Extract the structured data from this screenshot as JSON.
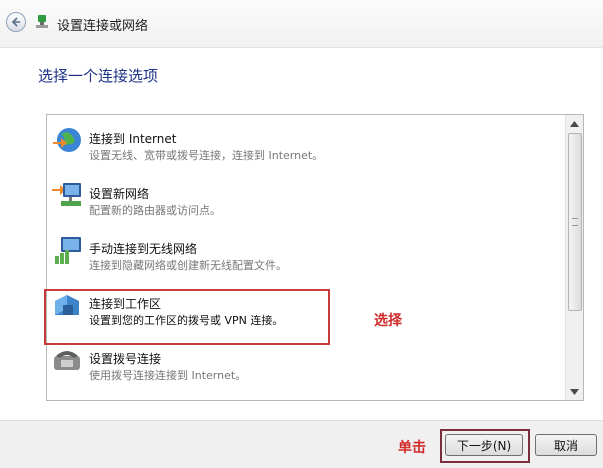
{
  "window": {
    "title": "设置连接或网络"
  },
  "main": {
    "heading": "选择一个连接选项"
  },
  "options": [
    {
      "title": "连接到 Internet",
      "description": "设置无线、宽带或拨号连接，连接到 Internet。",
      "icon": "globe-internet-icon"
    },
    {
      "title": "设置新网络",
      "description": "配置新的路由器或访问点。",
      "icon": "new-network-icon"
    },
    {
      "title": "手动连接到无线网络",
      "description": "连接到隐藏网络或创建新无线配置文件。",
      "icon": "wireless-network-icon"
    },
    {
      "title": "连接到工作区",
      "description": "设置到您的工作区的拨号或 VPN 连接。",
      "icon": "workplace-icon"
    },
    {
      "title": "设置拨号连接",
      "description": "使用拨号连接连接到 Internet。",
      "icon": "dialup-phone-icon"
    }
  ],
  "annotations": {
    "select": "选择",
    "click": "单击",
    "color": "#d02b2b"
  },
  "footer": {
    "next_label": "下一步(N)",
    "cancel_label": "取消"
  }
}
